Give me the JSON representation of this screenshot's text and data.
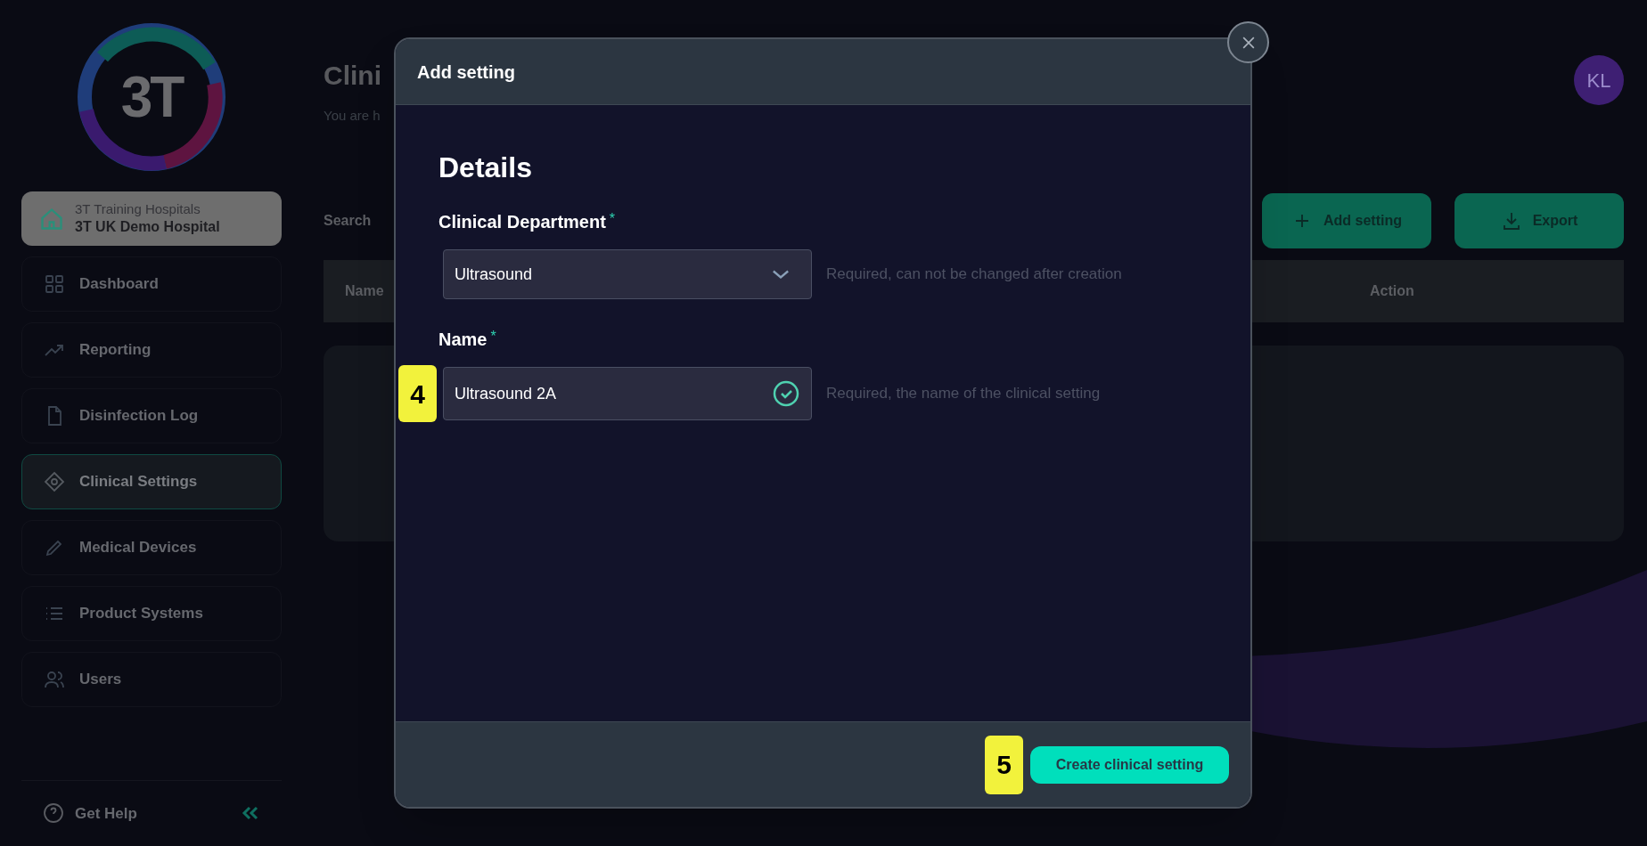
{
  "sidebar": {
    "logo": "3T",
    "organization": {
      "group": "3T Training Hospitals",
      "hospital": "3T UK Demo Hospital"
    },
    "items": [
      {
        "label": "Dashboard",
        "kind": "grid",
        "selected": false
      },
      {
        "label": "Reporting",
        "kind": "trend",
        "selected": false
      },
      {
        "label": "Disinfection Log",
        "kind": "file",
        "selected": false
      },
      {
        "label": "Clinical Settings",
        "kind": "target",
        "selected": true
      },
      {
        "label": "Medical Devices",
        "kind": "pen",
        "selected": false
      },
      {
        "label": "Product Systems",
        "kind": "list",
        "selected": false
      },
      {
        "label": "Users",
        "kind": "users",
        "selected": false
      }
    ],
    "help": "Get Help"
  },
  "page": {
    "title": "Clini",
    "subtitle": "You are h",
    "search_label": "Search",
    "buttons": [
      {
        "label": "Add setting",
        "kind": "plus"
      },
      {
        "label": "Export",
        "kind": "download"
      }
    ],
    "table_columns": [
      "Name",
      "Action"
    ],
    "avatar": "KL"
  },
  "modal": {
    "title": "Add setting",
    "section": "Details",
    "fields": [
      {
        "kind": "select",
        "label": "Clinical Department",
        "required_mark": "*",
        "value": "Ultrasound",
        "hint": "Required, can not be changed after creation",
        "valid": false
      },
      {
        "kind": "text",
        "label": "Name",
        "required_mark": "*",
        "value": "Ultrasound 2A",
        "hint": "Required, the name of the clinical setting",
        "valid": true,
        "step": "4"
      }
    ],
    "submit": {
      "label": "Create clinical setting",
      "step": "5"
    }
  }
}
